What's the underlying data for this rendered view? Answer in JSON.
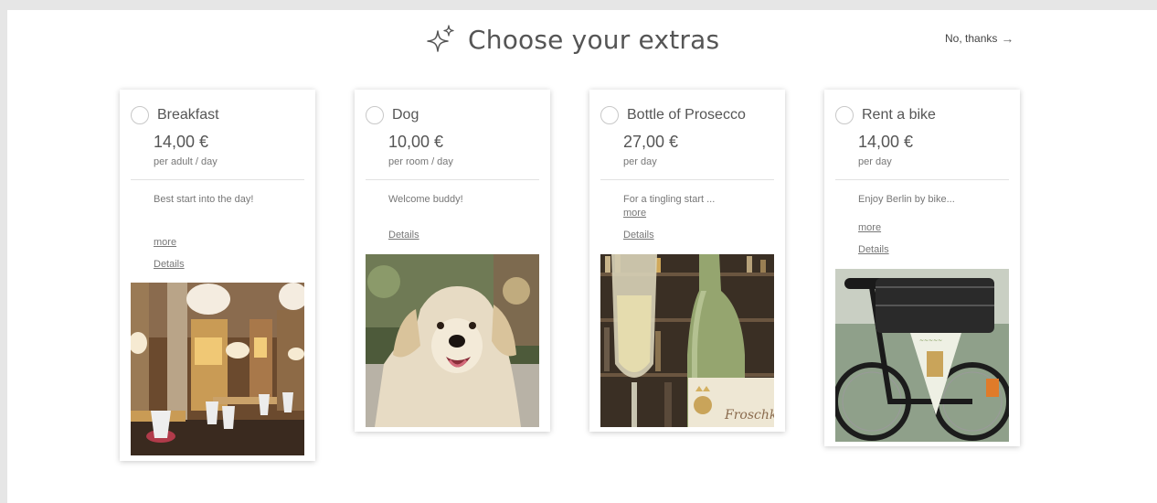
{
  "header": {
    "title": "Choose your extras",
    "icon": "sparkle-icon",
    "no_thanks_label": "No, thanks",
    "no_thanks_icon": "arrow-right-icon"
  },
  "cards": [
    {
      "name": "Breakfast",
      "price": "14,00 €",
      "unit": "per adult / day",
      "description": "Best start into the day!",
      "more_label": "more",
      "details_label": "Details",
      "photo": "restaurant-photo"
    },
    {
      "name": "Dog",
      "price": "10,00 €",
      "unit": "per room / day",
      "description": "Welcome buddy!",
      "details_label": "Details",
      "photo": "dog-photo"
    },
    {
      "name": "Bottle of Prosecco",
      "price": "27,00 €",
      "unit": "per day",
      "description": "For a tingling start ...",
      "more_label": "more",
      "details_label": "Details",
      "photo": "prosecco-photo",
      "label_text": "Froschkö"
    },
    {
      "name": "Rent a bike",
      "price": "14,00 €",
      "unit": "per day",
      "description": "Enjoy Berlin by bike...",
      "more_label": "more",
      "details_label": "Details",
      "photo": "bike-photo"
    }
  ]
}
